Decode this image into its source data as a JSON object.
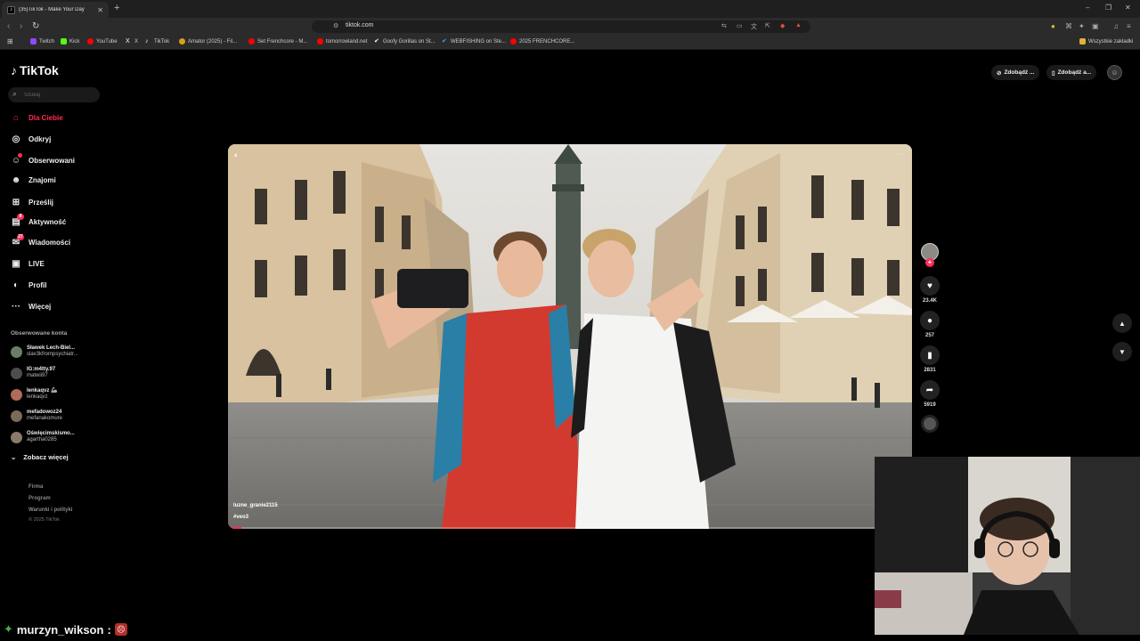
{
  "browser": {
    "tab": {
      "title": "(35)TikTok - Make Your Day",
      "favicon": "tiktok-icon"
    },
    "new_tab_label": "+",
    "window_controls": [
      "–",
      "❐",
      "✕"
    ],
    "url": "tiktok.com",
    "bookmarks": [
      {
        "label": "Twitch",
        "color": "#9146ff"
      },
      {
        "label": "Kick",
        "color": "#53fc18"
      },
      {
        "label": "YouTube",
        "color": "#ff0000"
      },
      {
        "label": "X",
        "color": "#ffffff"
      },
      {
        "label": "TikTok",
        "color": "#000000"
      },
      {
        "label": "Amator (2025) - Fil...",
        "color": "#d6a11a"
      },
      {
        "label": "Set Frenchcore - M...",
        "color": "#ff0000"
      },
      {
        "label": "tomorrowland.net",
        "color": "#ff0000"
      },
      {
        "label": "Goofy Gorillas on St...",
        "color": "#ffffff"
      },
      {
        "label": "WEBFISHING on Ste...",
        "color": "#4aa3df"
      },
      {
        "label": "2025 FRENCHCORE...",
        "color": "#ff0000"
      }
    ],
    "all_bookmarks": "Wszystkie zakładki"
  },
  "tiktok": {
    "logo": "TikTok",
    "search_placeholder": "Szukaj",
    "nav": [
      {
        "label": "Dla Ciebie",
        "icon": "home-icon",
        "active": true
      },
      {
        "label": "Odkryj",
        "icon": "compass-icon"
      },
      {
        "label": "Obserwowani",
        "icon": "following-icon"
      },
      {
        "label": "Znajomi",
        "icon": "friends-icon"
      },
      {
        "label": "Prześlij",
        "icon": "upload-icon"
      },
      {
        "label": "Aktywność",
        "icon": "activity-icon",
        "badge": "8"
      },
      {
        "label": "Wiadomości",
        "icon": "messages-icon",
        "badge": "27"
      },
      {
        "label": "LIVE",
        "icon": "live-icon"
      },
      {
        "label": "Profil",
        "icon": "profile-icon"
      },
      {
        "label": "Więcej",
        "icon": "more-icon"
      }
    ],
    "followed_title": "Obserwowane konta",
    "followed": [
      {
        "name": "Sławek Lech-Biel...",
        "handle": "slav3kfrompsychiatr...",
        "color": "#6d7b6a"
      },
      {
        "name": "IG:m4tty.97",
        "handle": "matwii97",
        "color": "#4c4c4c"
      },
      {
        "name": "lenkaqvz 🦾",
        "handle": "lenkaqvz",
        "color": "#b06b5a"
      },
      {
        "name": "mefadowoz24",
        "handle": "mefanakomure",
        "color": "#7a6a58"
      },
      {
        "name": "Oświęcimskismo...",
        "handle": "agartha0285",
        "color": "#8a7a6a"
      }
    ],
    "see_more": "Zobacz więcej",
    "footer": [
      "Firma",
      "Program",
      "Warunki i polityki"
    ],
    "copyright": "© 2025 TikTok",
    "top_buttons": [
      {
        "label": "Zdobądź ...",
        "icon": "coin-icon"
      },
      {
        "label": "Zdobądź a...",
        "icon": "phone-icon"
      }
    ]
  },
  "video": {
    "author": "luzne_granie2115",
    "tag": "#veo3",
    "progress": 0.02,
    "likes": "23.4K",
    "comments": "257",
    "saves": "2831",
    "shares": "5919"
  },
  "chat": {
    "user": "murzyn_wikson",
    "separator": ":"
  }
}
